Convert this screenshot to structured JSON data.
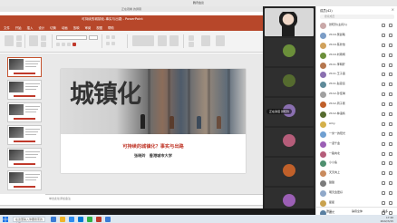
{
  "meeting": {
    "title": "腾讯会议"
  },
  "share_banner": "正在观看 的屏幕",
  "ppt": {
    "window_title": "可持续的城镇化-事实与出路 - PowerPoint",
    "menu": [
      "文件",
      "开始",
      "插入",
      "设计",
      "切换",
      "动画",
      "放映",
      "审阅",
      "视图",
      "帮助"
    ],
    "notes_placeholder": "单击此处添加备注",
    "status_left": "幻灯片 第1张，共12张"
  },
  "slide": {
    "headline": "城镇化",
    "subtitle": "可持续的城镇化？事实与出路",
    "author": "张晓玲　香港城市大学"
  },
  "thumbnails": [
    {
      "num": "1"
    },
    {
      "num": "2"
    },
    {
      "num": "3"
    },
    {
      "num": "4"
    },
    {
      "num": "5"
    },
    {
      "num": "6"
    }
  ],
  "video_tiles": [
    {
      "name": "",
      "color": "#d8d8d8"
    },
    {
      "name": "",
      "color": "#6b8f3a"
    },
    {
      "name": "",
      "color": "#556b2f"
    },
    {
      "name": "正在讲话 张晓玲",
      "color": "#8a6fb0"
    },
    {
      "name": "",
      "color": "#b55d7a"
    },
    {
      "name": "",
      "color": "#c0602a"
    },
    {
      "name": "",
      "color": "#9b5fb5"
    }
  ],
  "participants_panel": {
    "title": "成员(42)",
    "close": "×",
    "search_placeholder": "搜索成员",
    "footer": [
      "邀请",
      "静音全体",
      "更多"
    ],
    "items": [
      {
        "name": "张晓玲(主持人)",
        "color": "#c9a8a8"
      },
      {
        "name": "2110-吴晨曦",
        "color": "#7a9cc6"
      },
      {
        "name": "2110-陈欣怡",
        "color": "#d0a15c"
      },
      {
        "name": "2110-刘雨桐",
        "color": "#6b8f3a"
      },
      {
        "name": "2111-李明轩",
        "color": "#b5764e"
      },
      {
        "name": "2111-王子涵",
        "color": "#8a6fb0"
      },
      {
        "name": "2111-赵思远",
        "color": "#5e8a99"
      },
      {
        "name": "2112-孙佳琪",
        "color": "#a0a0a0"
      },
      {
        "name": "2112-周子豪",
        "color": "#c0602a"
      },
      {
        "name": "2112-林语嫣",
        "color": "#556b2f"
      },
      {
        "name": "Amy",
        "color": "#d4b04a"
      },
      {
        "name": "一米一的阳光",
        "color": "#6f9fd1"
      },
      {
        "name": "一诺千金",
        "color": "#9b5fb5"
      },
      {
        "name": "一路向北",
        "color": "#b55d7a"
      },
      {
        "name": "小小鱼",
        "color": "#4f8f6f"
      },
      {
        "name": "天天向上",
        "color": "#c98b5e"
      },
      {
        "name": "甜甜",
        "color": "#7b7b7b"
      },
      {
        "name": "明天会更好",
        "color": "#8fa8c9"
      },
      {
        "name": "星星",
        "color": "#c9a24f"
      },
      {
        "name": "晨光",
        "color": "#5a7fa0"
      }
    ]
  },
  "taskbar": {
    "search_placeholder": "在这里输入你要搜索的内容",
    "time": "17:26",
    "date": "2022/3/15",
    "icons": [
      "#3a7bd5",
      "#f0b429",
      "#2d8cf0",
      "#0078d4",
      "#2fb344",
      "#c0392b",
      "#3a7bd5"
    ]
  }
}
